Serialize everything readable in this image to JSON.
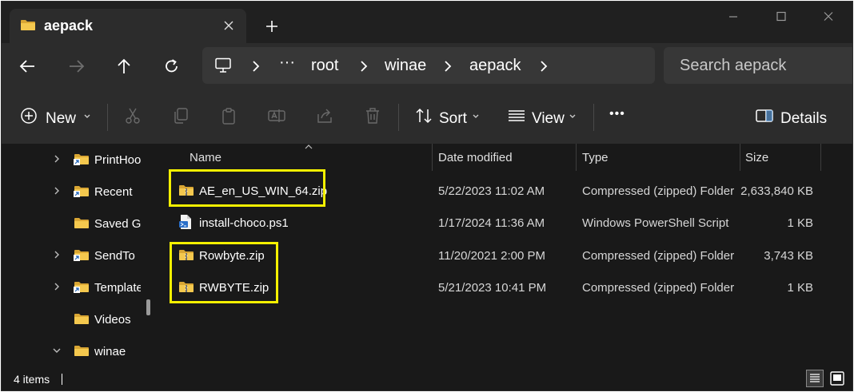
{
  "window": {
    "tab_title": "aepack",
    "new_tab_icon": "plus-icon",
    "controls": [
      "minimize-icon",
      "maximize-icon",
      "close-icon"
    ]
  },
  "nav": {
    "breadcrumb": {
      "overflow": "···",
      "items": [
        "root",
        "winae",
        "aepack"
      ]
    },
    "search_placeholder": "Search aepack"
  },
  "commands": {
    "new_label": "New",
    "sort_label": "Sort",
    "view_label": "View",
    "more_label": "•••",
    "details_label": "Details",
    "icons": [
      "cut-icon",
      "copy-icon",
      "paste-icon",
      "rename-icon",
      "share-icon",
      "delete-icon"
    ]
  },
  "tree": {
    "items": [
      {
        "label": "PrintHoo",
        "expandable": true,
        "shortcut": true
      },
      {
        "label": "Recent",
        "expandable": true,
        "shortcut": true
      },
      {
        "label": "Saved Ga",
        "expandable": false,
        "shortcut": false
      },
      {
        "label": "SendTo",
        "expandable": true,
        "shortcut": true
      },
      {
        "label": "Template",
        "expandable": true,
        "shortcut": true
      },
      {
        "label": "Videos",
        "expandable": false,
        "shortcut": false
      },
      {
        "label": "winae",
        "expanded": true,
        "shortcut": false
      }
    ]
  },
  "columns": {
    "name": "Name",
    "date": "Date modified",
    "type": "Type",
    "size": "Size"
  },
  "files": [
    {
      "name": "AE_en_US_WIN_64.zip",
      "date": "5/22/2023 11:02 AM",
      "type": "Compressed (zipped) Folder",
      "size": "2,633,840 KB",
      "icon": "zip-folder-icon"
    },
    {
      "name": "install-choco.ps1",
      "date": "1/17/2024 11:36 AM",
      "type": "Windows PowerShell Script",
      "size": "1 KB",
      "icon": "powershell-script-icon"
    },
    {
      "name": "Rowbyte.zip",
      "date": "11/20/2021 2:00 PM",
      "type": "Compressed (zipped) Folder",
      "size": "3,743 KB",
      "icon": "zip-folder-icon"
    },
    {
      "name": "RWBYTE.zip",
      "date": "5/21/2023 10:41 PM",
      "type": "Compressed (zipped) Folder",
      "size": "1 KB",
      "icon": "zip-folder-icon"
    }
  ],
  "status": {
    "item_count": "4 items"
  },
  "colors": {
    "highlight": "#f4f000",
    "folder": "#f0c24a",
    "background": "#191919",
    "toolbar": "#2c2c2c"
  }
}
